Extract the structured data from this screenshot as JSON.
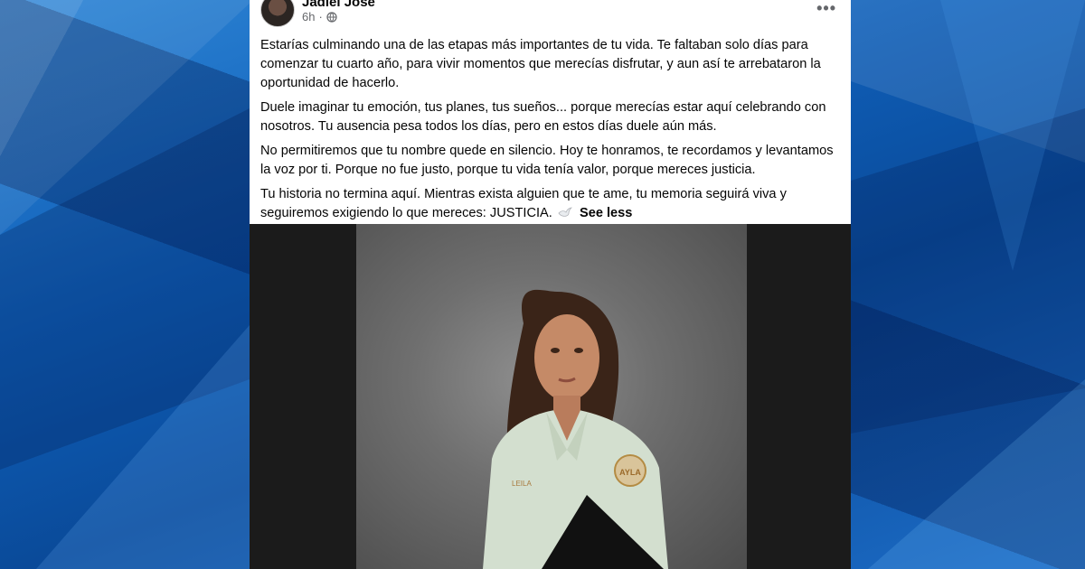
{
  "post": {
    "author": "Jadiel José",
    "time": "6h",
    "separator": "·",
    "more_label": "•••",
    "paragraphs": [
      "Estarías culminando una de las etapas más importantes de tu vida. Te faltaban solo días para comenzar tu cuarto año, para vivir momentos que merecías disfrutar, y aun así te arrebataron la oportunidad de hacerlo.",
      "Duele imaginar tu emoción, tus planes, tus sueños... porque merecías estar aquí celebrando con nosotros. Tu ausencia pesa todos los días, pero en estos días duele aún más.",
      "No permitiremos que tu nombre quede en silencio. Hoy te honramos, te recordamos y levantamos la voz por ti. Porque no fue justo, porque tu vida tenía valor, porque mereces justicia.",
      "Tu historia no termina aquí. Mientras exista alguien que te ame, tu memoria seguirá viva y seguiremos exigiendo lo que mereces: JUSTICIA."
    ],
    "see_less": "See less",
    "photo": {
      "name_tag": "LEILA",
      "school_badge": "AYLA"
    }
  },
  "icons": {
    "globe": "globe-icon",
    "more": "more-options-icon",
    "dove": "dove-icon"
  },
  "colors": {
    "background_blue": "#0d4f9e",
    "card": "#ffffff",
    "text": "#050505",
    "secondary_text": "#65676b",
    "media_bg": "#1b1b1b"
  }
}
